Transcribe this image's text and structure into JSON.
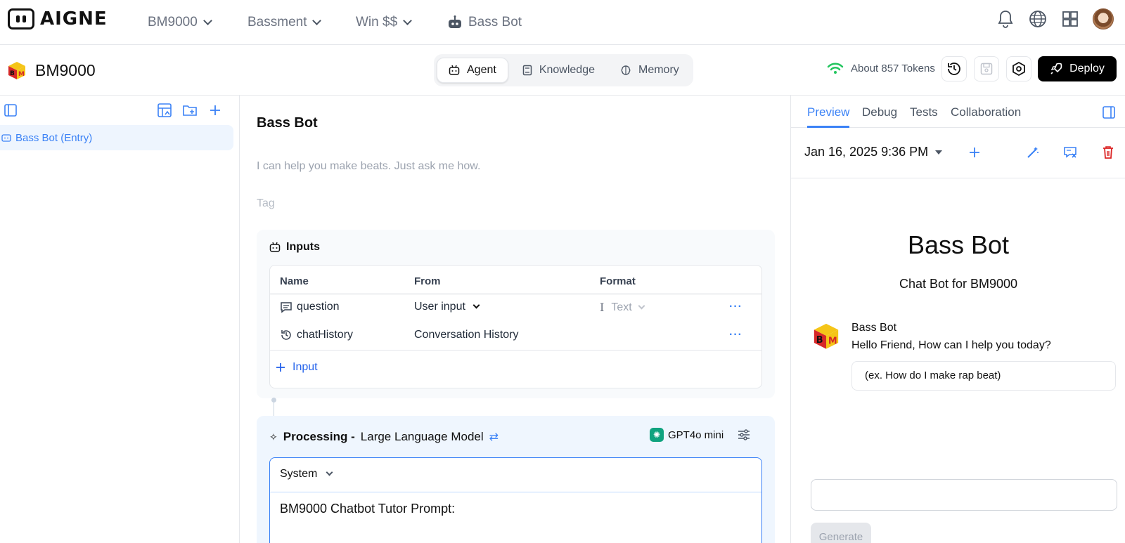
{
  "brand": {
    "name": "AIGNE"
  },
  "topnav": {
    "items": [
      {
        "label": "BM9000",
        "icon": "chevron-down-icon"
      },
      {
        "label": "Bassment",
        "icon": "chevron-down-icon"
      },
      {
        "label": "Win $$",
        "icon": "chevron-down-icon"
      },
      {
        "label": "Bass Bot",
        "icon": "robot-icon"
      }
    ],
    "right_icons": [
      "bell-icon",
      "globe-icon",
      "apps-grid-icon",
      "user-avatar"
    ]
  },
  "project": {
    "name": "BM9000",
    "mode_tabs": [
      {
        "label": "Agent",
        "active": true,
        "icon": "robot-icon"
      },
      {
        "label": "Knowledge",
        "active": false,
        "icon": "book-icon"
      },
      {
        "label": "Memory",
        "active": false,
        "icon": "brain-icon"
      }
    ],
    "tokens_label": "About 857 Tokens",
    "deploy_label": "Deploy"
  },
  "sidebar": {
    "entry_label": "Bass Bot (Entry)"
  },
  "agent": {
    "title": "Bass Bot",
    "description": "I can help you make beats. Just ask me how.",
    "tag_placeholder": "Tag"
  },
  "inputs": {
    "heading": "Inputs",
    "columns": [
      "Name",
      "From",
      "Format"
    ],
    "rows": [
      {
        "name": "question",
        "from": "User input",
        "format": "Text",
        "icon": "chat-bubble-icon"
      },
      {
        "name": "chatHistory",
        "from": "Conversation History",
        "format": "",
        "icon": "history-icon"
      }
    ],
    "add_label": "Input"
  },
  "processing": {
    "label": "Processing -",
    "type": "Large Language Model",
    "model": "GPT4o mini",
    "role": "System",
    "prompt_first_line": "BM9000 Chatbot Tutor Prompt:"
  },
  "preview": {
    "tabs": [
      {
        "label": "Preview",
        "active": true
      },
      {
        "label": "Debug",
        "active": false
      },
      {
        "label": "Tests",
        "active": false
      },
      {
        "label": "Collaboration",
        "active": false
      }
    ],
    "session_date": "Jan 16, 2025 9:36 PM",
    "bot_title": "Bass Bot",
    "bot_subtitle": "Chat Bot for BM9000",
    "message": {
      "sender": "Bass Bot",
      "text": "Hello Friend, How can I help you today?",
      "example": "(ex. How do I make rap beat)"
    },
    "generate_label": "Generate"
  },
  "colors": {
    "accent": "#3b82f6",
    "danger": "#dc2626",
    "signal": "#22c55e",
    "gpt": "#10a37f"
  }
}
